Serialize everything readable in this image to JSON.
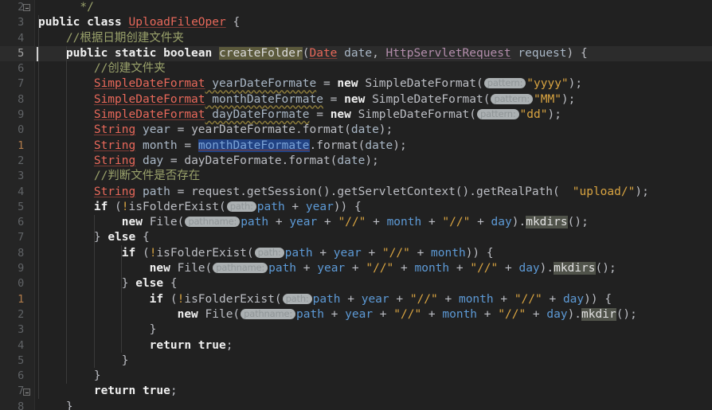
{
  "editor": {
    "theme_background": "#212121",
    "gutter_background": "#252525",
    "current_line_background": "#2c2c2c",
    "caret_line": 5,
    "language": "Java"
  },
  "colors": {
    "keyword": "#f0f0f0",
    "type": "#e8685a",
    "comment": "#9aa26b",
    "string": "#d9a441",
    "field": "#5d9ad6",
    "plain": "#bcbec4",
    "selection": "#214283",
    "highlight_olive": "#5c5a3c",
    "highlight_grey": "#50534a",
    "hint_badge": "#abb0b2"
  },
  "hints": {
    "pattern": "pattern:",
    "path": "path:",
    "pathname": "pathname:",
    "blank": ""
  },
  "lines": [
    {
      "num": "2",
      "modified": false,
      "current": false,
      "text": "        */"
    },
    {
      "num": "3",
      "modified": false,
      "current": false,
      "text": "    public class UploadFileOper {"
    },
    {
      "num": "4",
      "modified": false,
      "current": false,
      "text": "        //根据日期创建文件夹"
    },
    {
      "num": "5",
      "modified": false,
      "current": true,
      "text": "        public static boolean createFolder(Date date, HttpServletRequest request) {"
    },
    {
      "num": "6",
      "modified": false,
      "current": false,
      "text": "            //创建文件夹"
    },
    {
      "num": "7",
      "modified": false,
      "current": false,
      "text": "            SimpleDateFormat yearDateFormate = new SimpleDateFormat(pattern: \"yyyy\");"
    },
    {
      "num": "8",
      "modified": false,
      "current": false,
      "text": "            SimpleDateFormat monthDateFormate = new SimpleDateFormat(pattern: \"MM\");"
    },
    {
      "num": "9",
      "modified": false,
      "current": false,
      "text": "            SimpleDateFormat dayDateFormate = new SimpleDateFormat(pattern: \"dd\");"
    },
    {
      "num": "0",
      "modified": false,
      "current": false,
      "text": "            String year = yearDateFormate.format(date);"
    },
    {
      "num": "1",
      "modified": true,
      "current": false,
      "text": "            String month = monthDateFormate.format(date);"
    },
    {
      "num": "2",
      "modified": false,
      "current": false,
      "text": "            String day = dayDateFormate.format(date);"
    },
    {
      "num": "3",
      "modified": false,
      "current": false,
      "text": "            //判断文件是否存在"
    },
    {
      "num": "4",
      "modified": false,
      "current": false,
      "text": "            String path = request.getSession().getServletContext().getRealPath(\"upload/\");"
    },
    {
      "num": "5",
      "modified": false,
      "current": false,
      "text": "            if (!isFolderExist(path: path + year)) {"
    },
    {
      "num": "6",
      "modified": false,
      "current": false,
      "text": "                new File(pathname: path + year + \"//\" + month + \"//\" + day).mkdirs();"
    },
    {
      "num": "7",
      "modified": false,
      "current": false,
      "text": "            } else {"
    },
    {
      "num": "8",
      "modified": false,
      "current": false,
      "text": "                if (!isFolderExist(path: path + year + \"//\" + month)) {"
    },
    {
      "num": "9",
      "modified": false,
      "current": false,
      "text": "                    new File(pathname: path + year + \"//\" + month + \"//\" + day).mkdirs();"
    },
    {
      "num": "0",
      "modified": false,
      "current": false,
      "text": "                } else {"
    },
    {
      "num": "1",
      "modified": true,
      "current": false,
      "text": "                    if (!isFolderExist(path: path + year + \"//\" + month + \"//\" + day)) {"
    },
    {
      "num": "2",
      "modified": false,
      "current": false,
      "text": "                        new File(pathname: path + year + \"//\" + month + \"//\" + day).mkdir();"
    },
    {
      "num": "3",
      "modified": false,
      "current": false,
      "text": "                    }"
    },
    {
      "num": "4",
      "modified": false,
      "current": false,
      "text": "                    return true;"
    },
    {
      "num": "5",
      "modified": false,
      "current": false,
      "text": "                }"
    },
    {
      "num": "6",
      "modified": false,
      "current": false,
      "text": "            }"
    },
    {
      "num": "7",
      "modified": false,
      "current": false,
      "text": "            return true;"
    },
    {
      "num": "8",
      "modified": false,
      "current": false,
      "text": "        }"
    }
  ],
  "identifiers": {
    "class_name": "UploadFileOper",
    "method_name": "createFolder",
    "params": [
      "Date date",
      "HttpServletRequest request"
    ],
    "locals": [
      "yearDateFormate",
      "monthDateFormate",
      "dayDateFormate",
      "year",
      "month",
      "day",
      "path"
    ],
    "selected_identifier": "monthDateFormate",
    "highlighted_calls": [
      "mkdirs",
      "mkdir"
    ],
    "string_literals": [
      "\"yyyy\"",
      "\"MM\"",
      "\"dd\"",
      "\"upload/\"",
      "\"//\""
    ],
    "comments": [
      "*/",
      "//根据日期创建文件夹",
      "//创建文件夹",
      "//判断文件是否存在"
    ]
  }
}
